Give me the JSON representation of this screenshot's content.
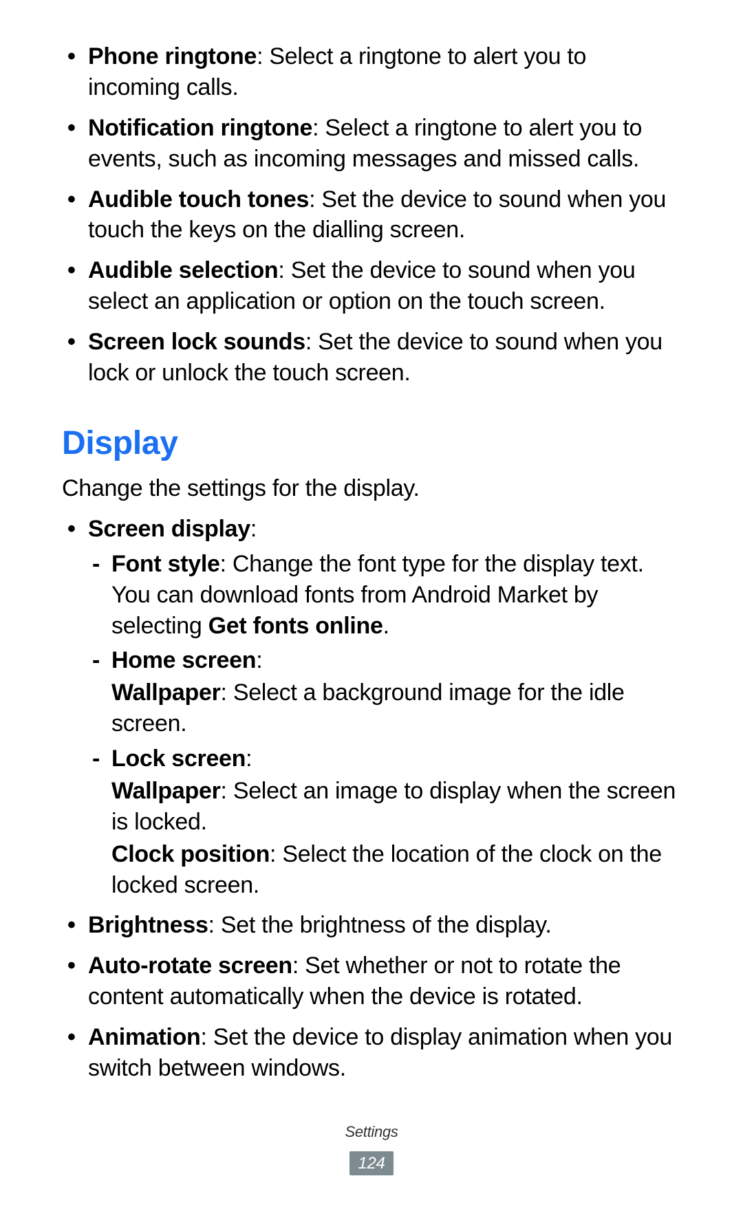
{
  "sound_items": [
    {
      "term": "Phone ringtone",
      "desc": ": Select a ringtone to alert you to incoming calls."
    },
    {
      "term": "Notification ringtone",
      "desc": ": Select a ringtone to alert you to events, such as incoming messages and missed calls."
    },
    {
      "term": "Audible touch tones",
      "desc": ": Set the device to sound when you touch the keys on the dialling screen."
    },
    {
      "term": "Audible selection",
      "desc": ": Set the device to sound when you select an application or option on the touch screen."
    },
    {
      "term": "Screen lock sounds",
      "desc": ": Set the device to sound when you lock or unlock the touch screen."
    }
  ],
  "display": {
    "heading": "Display",
    "intro": "Change the settings for the display.",
    "screen_display": {
      "label": "Screen display",
      "colon": ":",
      "font_style": {
        "term": "Font style",
        "desc": ": Change the font type for the display text. You can download fonts from Android Market by selecting ",
        "bold_tail": "Get fonts online",
        "period": "."
      },
      "home_screen": {
        "term": "Home screen",
        "colon": ":",
        "wallpaper_term": "Wallpaper",
        "wallpaper_desc": ": Select a background image for the idle screen."
      },
      "lock_screen": {
        "term": "Lock screen",
        "colon": ":",
        "wallpaper_term": "Wallpaper",
        "wallpaper_desc": ": Select an image to display when the screen is locked.",
        "clock_term": "Clock position",
        "clock_desc": ": Select the location of the clock on the locked screen."
      }
    },
    "brightness": {
      "term": "Brightness",
      "desc": ": Set the brightness of the display."
    },
    "auto_rotate": {
      "term": "Auto-rotate screen",
      "desc": ": Set whether or not to rotate the content automatically when the device is rotated."
    },
    "animation": {
      "term": "Animation",
      "desc": ": Set the device to display animation when you switch between windows."
    }
  },
  "footer": {
    "section": "Settings",
    "page": "124"
  }
}
